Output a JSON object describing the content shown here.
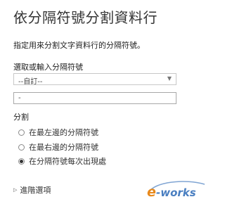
{
  "dialog": {
    "title": "依分隔符號分割資料行",
    "description": "指定用來分割文字資料行的分隔符號。"
  },
  "delimiter": {
    "label": "選取或輸入分隔符號",
    "selected": "--自訂--",
    "input_value": "-"
  },
  "split": {
    "label": "分割",
    "options": [
      {
        "label": "在最左邊的分隔符號",
        "checked": false
      },
      {
        "label": "在最右邊的分隔符號",
        "checked": false
      },
      {
        "label": "在分隔符號每次出現處",
        "checked": true
      }
    ]
  },
  "advanced": {
    "label": "進階選項"
  },
  "watermark": {
    "text": "e-works",
    "colors": {
      "orange": "#e8891c",
      "blue": "#4a7fc1"
    }
  },
  "icons": {
    "dropdown": "chevron-down-icon",
    "advanced": "triangle-right-icon"
  }
}
